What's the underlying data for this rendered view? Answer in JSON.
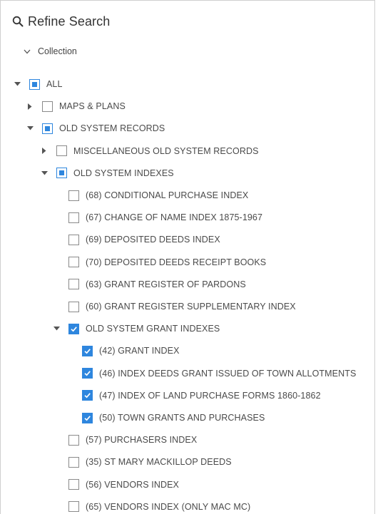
{
  "panel": {
    "title": "Refine Search",
    "section_label": "Collection"
  },
  "colors": {
    "accent": "#2e86de",
    "text": "#4a4a4a",
    "border": "#8a8a8a"
  },
  "icons": {
    "header": "search-icon",
    "section": "chevron-down-icon",
    "expanded": "caret-down-icon",
    "collapsed": "caret-right-icon"
  },
  "tree": [
    {
      "label": "ALL",
      "state": "partial",
      "toggle": "expanded",
      "depth": 0
    },
    {
      "label": "MAPS & PLANS",
      "state": "unchecked",
      "toggle": "collapsed",
      "depth": 1
    },
    {
      "label": "OLD SYSTEM RECORDS",
      "state": "partial",
      "toggle": "expanded",
      "depth": 1
    },
    {
      "label": "MISCELLANEOUS OLD SYSTEM RECORDS",
      "state": "unchecked",
      "toggle": "collapsed",
      "depth": 2
    },
    {
      "label": "OLD SYSTEM INDEXES",
      "state": "partial",
      "toggle": "expanded",
      "depth": 2
    },
    {
      "label": "(68) CONDITIONAL PURCHASE INDEX",
      "state": "unchecked",
      "toggle": "none",
      "depth": 3
    },
    {
      "label": "(67) CHANGE OF NAME INDEX 1875-1967",
      "state": "unchecked",
      "toggle": "none",
      "depth": 3
    },
    {
      "label": "(69) DEPOSITED DEEDS INDEX",
      "state": "unchecked",
      "toggle": "none",
      "depth": 3
    },
    {
      "label": "(70) DEPOSITED DEEDS RECEIPT BOOKS",
      "state": "unchecked",
      "toggle": "none",
      "depth": 3
    },
    {
      "label": "(63) GRANT REGISTER OF PARDONS",
      "state": "unchecked",
      "toggle": "none",
      "depth": 3
    },
    {
      "label": "(60) GRANT REGISTER SUPPLEMENTARY INDEX",
      "state": "unchecked",
      "toggle": "none",
      "depth": 3
    },
    {
      "label": "OLD SYSTEM GRANT INDEXES",
      "state": "checked",
      "toggle": "expanded",
      "depth": 3
    },
    {
      "label": "(42) GRANT INDEX",
      "state": "checked",
      "toggle": "none",
      "depth": 4
    },
    {
      "label": "(46) INDEX DEEDS GRANT ISSUED OF TOWN ALLOTMENTS",
      "state": "checked",
      "toggle": "none",
      "depth": 4
    },
    {
      "label": "(47) INDEX OF LAND PURCHASE FORMS 1860-1862",
      "state": "checked",
      "toggle": "none",
      "depth": 4
    },
    {
      "label": "(50) TOWN GRANTS AND PURCHASES",
      "state": "checked",
      "toggle": "none",
      "depth": 4
    },
    {
      "label": "(57) PURCHASERS INDEX",
      "state": "unchecked",
      "toggle": "none",
      "depth": 3
    },
    {
      "label": "(35) ST MARY MACKILLOP DEEDS",
      "state": "unchecked",
      "toggle": "none",
      "depth": 3
    },
    {
      "label": "(56) VENDORS INDEX",
      "state": "unchecked",
      "toggle": "none",
      "depth": 3
    },
    {
      "label": "(65) VENDORS INDEX (ONLY MAC MC)",
      "state": "unchecked",
      "toggle": "none",
      "depth": 3
    }
  ]
}
